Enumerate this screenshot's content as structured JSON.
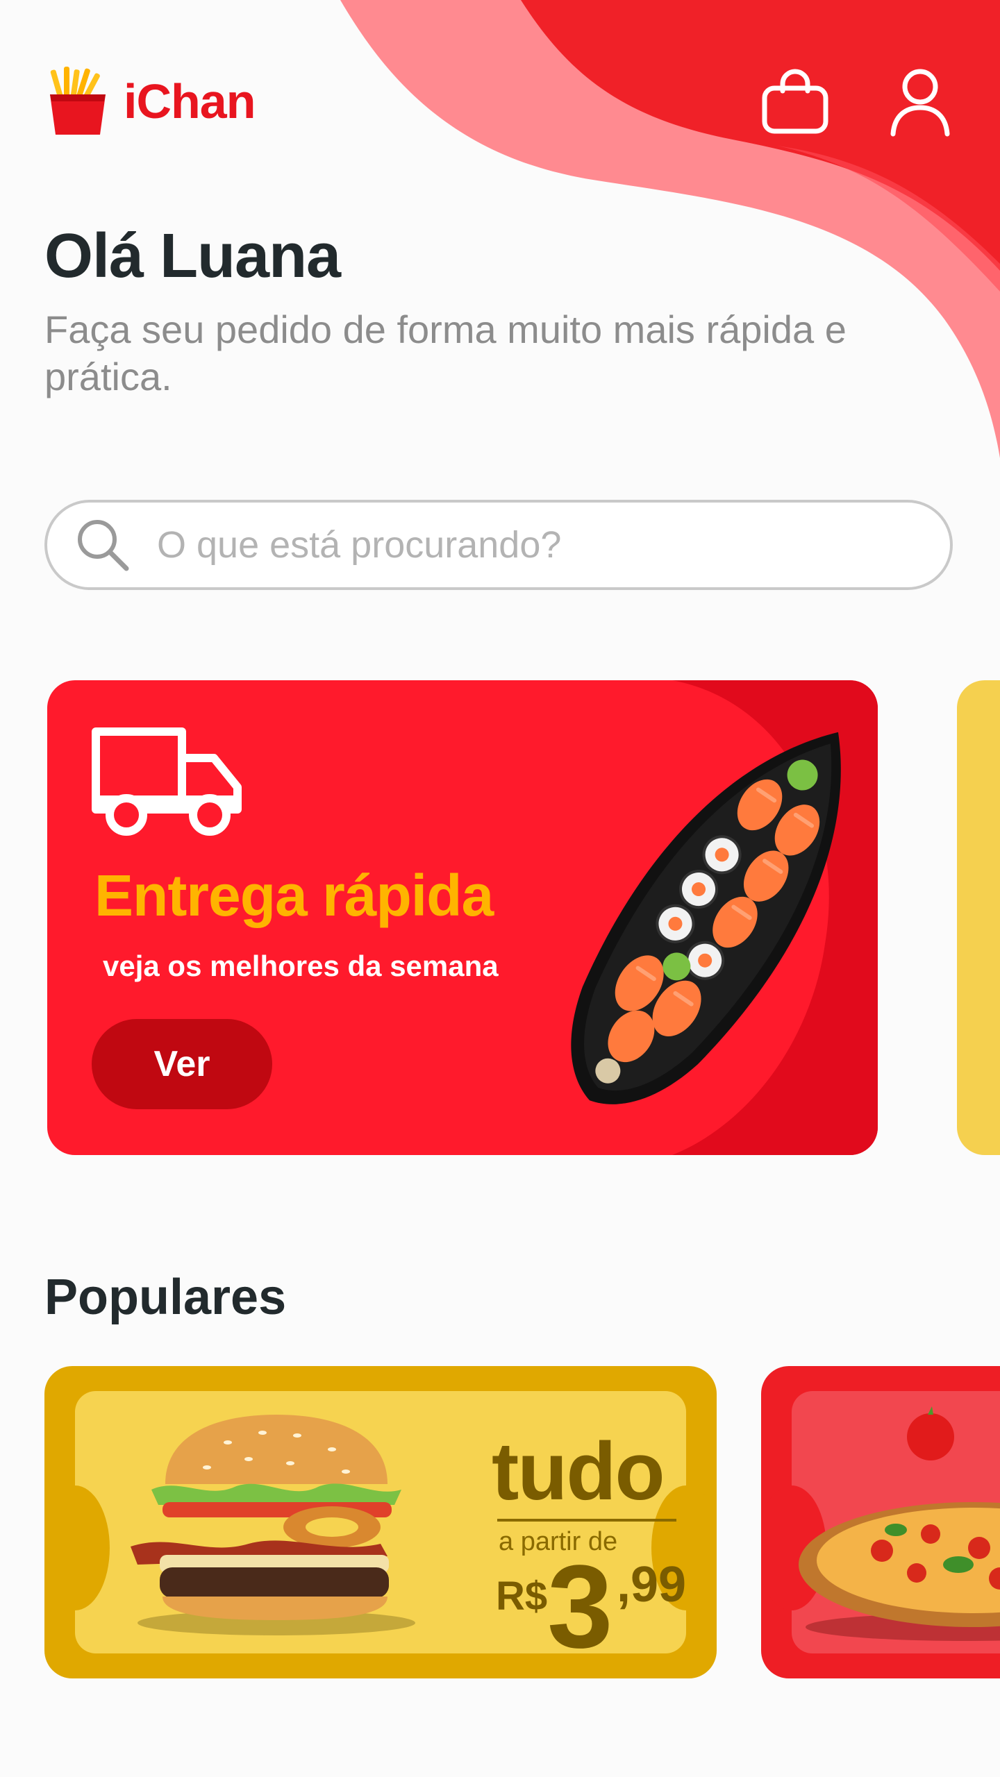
{
  "app": {
    "name": "iChan"
  },
  "colors": {
    "brand_red": "#e8151f",
    "banner_red": "#ff1a2c",
    "accent_yellow": "#ffb400",
    "coupon_yellow": "#f6d350",
    "text_dark": "#222a2d",
    "text_muted": "#8c8c8c"
  },
  "header": {
    "logo_icon": "fries-icon",
    "cart_icon": "shopping-bag-icon",
    "profile_icon": "user-icon"
  },
  "greeting": {
    "title": "Olá Luana",
    "subtitle": "Faça seu pedido de forma muito mais rápida e prática."
  },
  "search": {
    "placeholder": "O que está procurando?",
    "icon": "search-icon"
  },
  "banner": {
    "icon": "delivery-truck-icon",
    "title": "Entrega rápida",
    "subtitle": "veja os melhores da semana",
    "button_label": "Ver",
    "image": "sushi-boat-image"
  },
  "popular": {
    "title": "Populares",
    "cards": [
      {
        "image": "burger-image",
        "headline": "tudo",
        "from_label": "a partir de",
        "currency": "R$",
        "price_int": "3",
        "price_dec": ",99"
      },
      {
        "image": "pizza-image"
      }
    ]
  }
}
